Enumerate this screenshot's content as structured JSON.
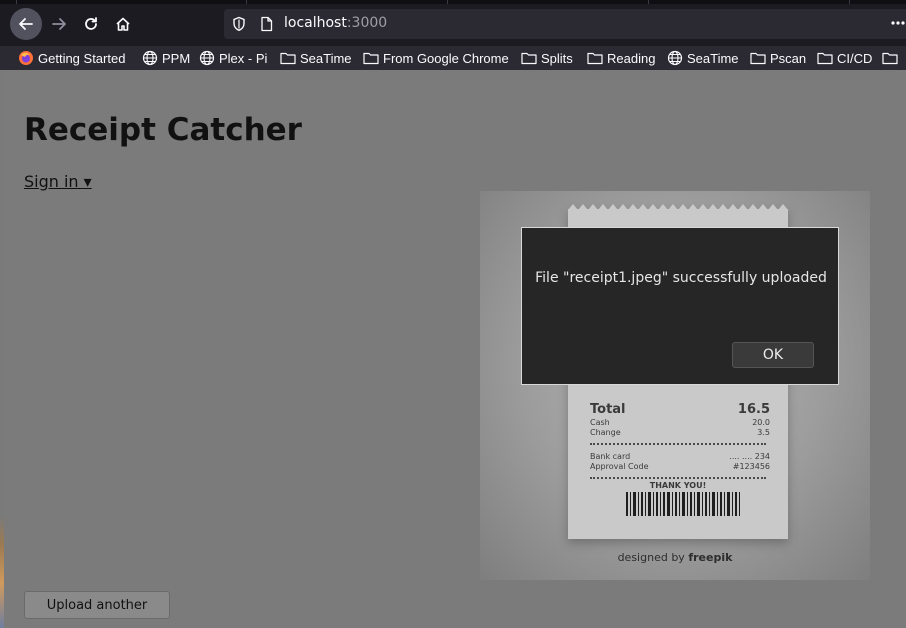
{
  "browser": {
    "url_host": "localhost",
    "url_port": ":3000",
    "bookmarks": [
      {
        "label": "Getting Started",
        "icon": "firefox-icon"
      },
      {
        "label": "PPM",
        "icon": "globe-icon"
      },
      {
        "label": "Plex - Pi",
        "icon": "globe-icon"
      },
      {
        "label": "SeaTime",
        "icon": "folder-icon"
      },
      {
        "label": "From Google Chrome",
        "icon": "folder-icon"
      },
      {
        "label": "Splits",
        "icon": "folder-icon"
      },
      {
        "label": "Reading",
        "icon": "folder-icon"
      },
      {
        "label": "SeaTime",
        "icon": "globe-icon"
      },
      {
        "label": "Pscan",
        "icon": "folder-icon"
      },
      {
        "label": "CI/CD",
        "icon": "folder-icon"
      }
    ]
  },
  "page": {
    "title": "Receipt Catcher",
    "signin_label": "Sign in ▾",
    "upload_another_label": "Upload another"
  },
  "receipt_image": {
    "total_label": "Total",
    "total_value": "16.5",
    "cash_label": "Cash",
    "cash_value": "20.0",
    "change_label": "Change",
    "change_value": "3.5",
    "bank_card_label": "Bank card",
    "bank_card_value": ".... .... 234",
    "approval_label": "Approval Code",
    "approval_value": "#123456",
    "thank_you": "THANK YOU!",
    "credit_prefix": "designed by",
    "credit_brand": "freepik"
  },
  "dialog": {
    "message": "File \"receipt1.jpeg\" successfully uploaded",
    "ok_label": "OK"
  },
  "colors": {
    "overlay": "#7b7b7b",
    "dialog_bg": "#262626",
    "toolbar_bg": "#1c1b22"
  }
}
